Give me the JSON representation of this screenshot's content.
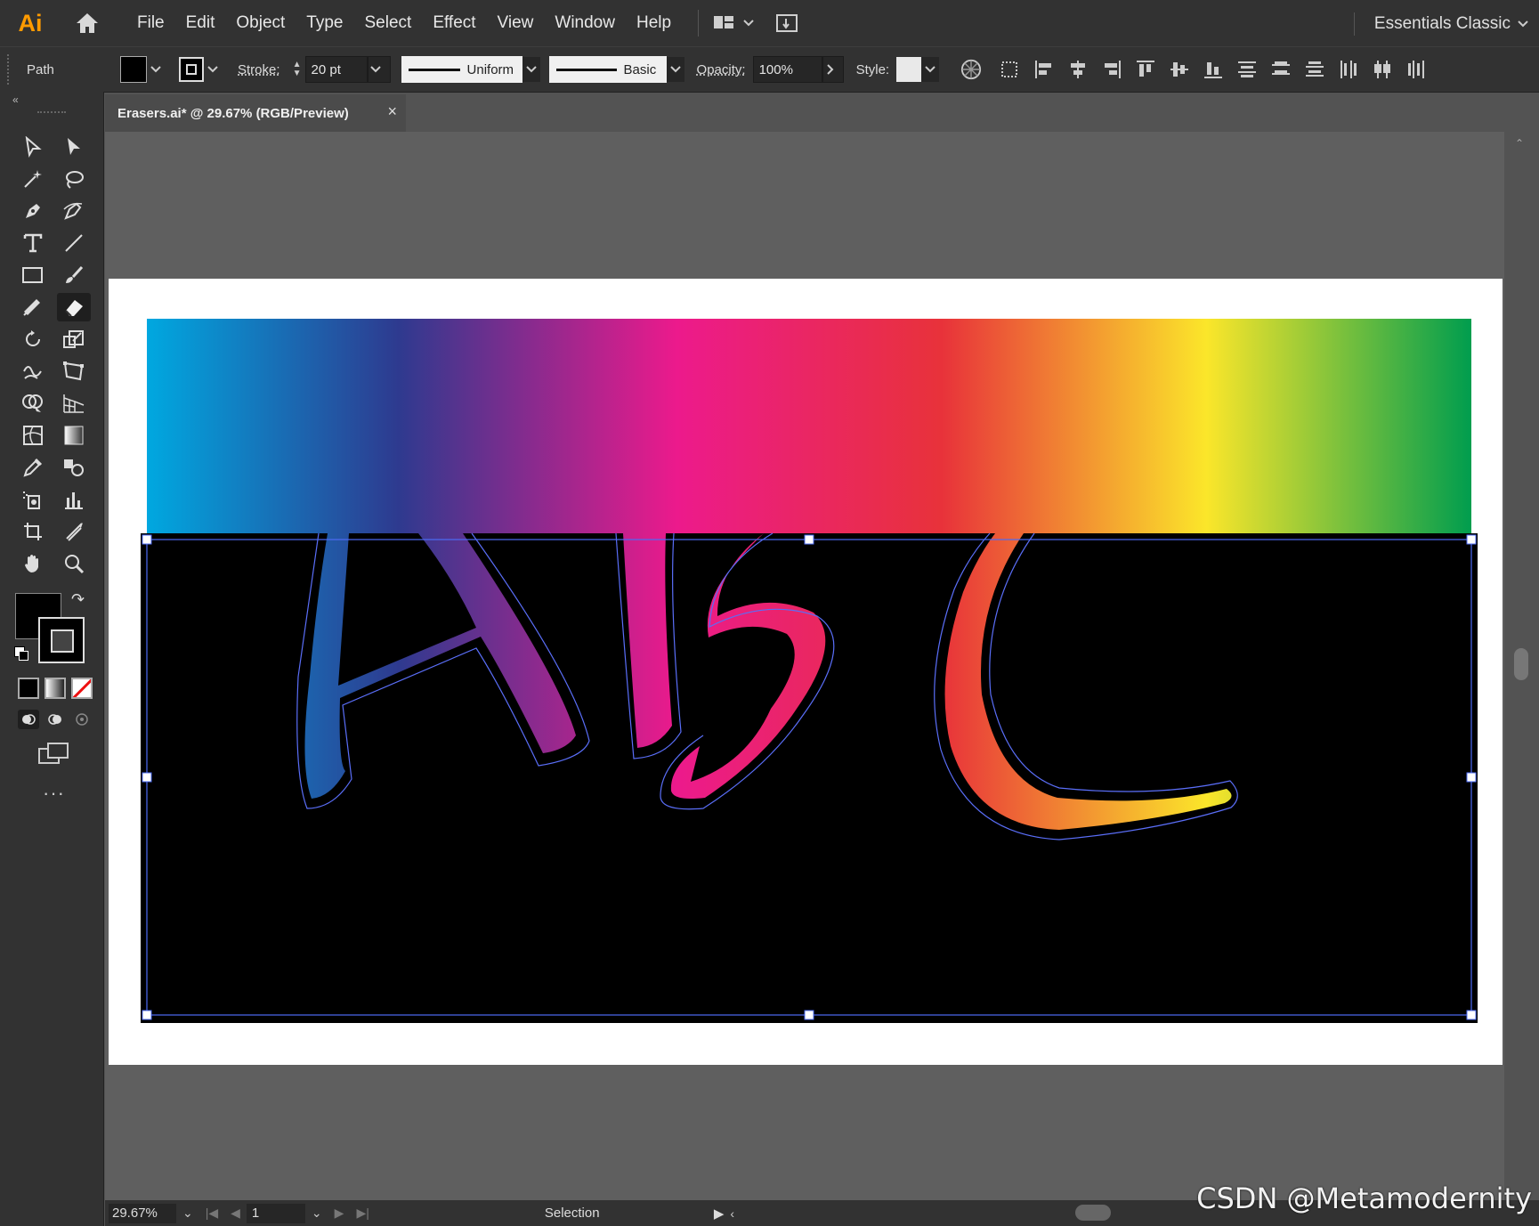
{
  "app": {
    "logo": "Ai",
    "menu": [
      "File",
      "Edit",
      "Object",
      "Type",
      "Select",
      "Effect",
      "View",
      "Window",
      "Help"
    ],
    "workspace": "Essentials Classic"
  },
  "control_bar": {
    "selection_type": "Path",
    "stroke_label": "Stroke:",
    "stroke_weight": "20 pt",
    "variable_width_profile": "Uniform",
    "brush_definition": "Basic",
    "opacity_label": "Opacity:",
    "opacity_value": "100%",
    "style_label": "Style:"
  },
  "document": {
    "tab_title": "Erasers.ai* @ 29.67% (RGB/Preview)",
    "close": "×"
  },
  "status_bar": {
    "zoom": "29.67%",
    "artboard_number": "1",
    "current_tool": "Selection"
  },
  "watermark": "CSDN @Metamodernity",
  "colors": {
    "gradient_stops": [
      "#00a8e0",
      "#2e3a8f",
      "#ec1a8c",
      "#e8323a",
      "#fbe62a",
      "#009d4e"
    ],
    "selection_blue": "#4d6bf5",
    "ui_dark": "#323232"
  },
  "icons": [
    "home-icon",
    "arrange-documents-icon",
    "share-icon",
    "selection-tool-icon",
    "direct-selection-tool-icon",
    "magic-wand-icon",
    "lasso-icon",
    "pen-tool-icon",
    "curvature-tool-icon",
    "type-tool-icon",
    "line-segment-tool-icon",
    "rectangle-tool-icon",
    "paintbrush-icon",
    "shaper-tool-icon",
    "eraser-tool-icon",
    "rotate-tool-icon",
    "scale-tool-icon",
    "warp-tool-icon",
    "free-transform-icon",
    "shape-builder-icon",
    "perspective-grid-icon",
    "mesh-tool-icon",
    "gradient-tool-icon",
    "eyedropper-icon",
    "blend-tool-icon",
    "symbol-sprayer-icon",
    "column-graph-icon",
    "artboard-tool-icon",
    "slice-tool-icon",
    "hand-tool-icon",
    "zoom-tool-icon",
    "recolor-icon"
  ]
}
